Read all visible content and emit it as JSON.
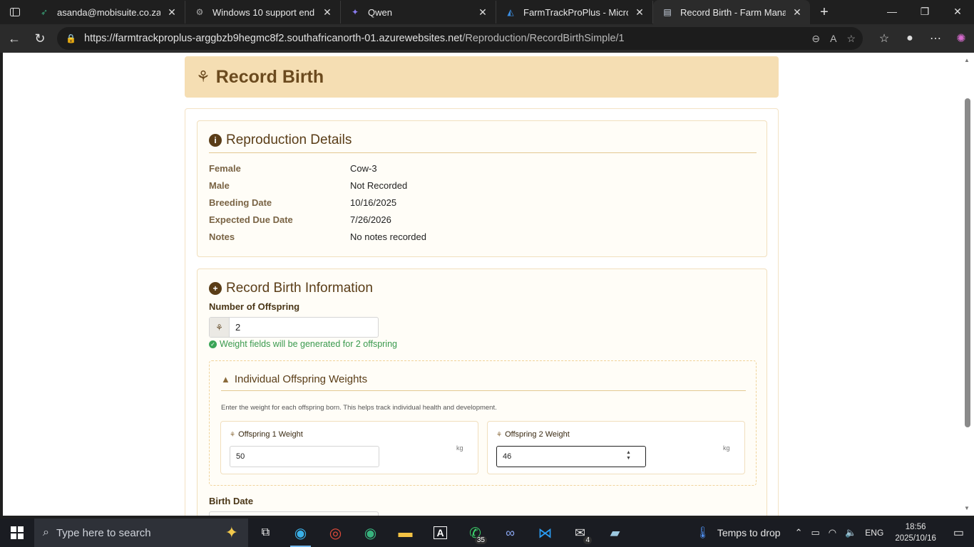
{
  "browser": {
    "tabs": [
      {
        "title": "asanda@mobisuite.co.za | Mo",
        "icon": "leaf-icon",
        "color": "#3aa57a"
      },
      {
        "title": "Windows 10 support end",
        "icon": "gear-icon",
        "color": "#9a9a9a"
      },
      {
        "title": "Qwen",
        "icon": "qwen-icon",
        "color": "#8a7cf0"
      },
      {
        "title": "FarmTrackProPlus - Microsoft",
        "icon": "azure-icon",
        "color": "#3b8de0"
      },
      {
        "title": "Record Birth - Farm Managem",
        "icon": "page-icon",
        "color": "#cfd8e6",
        "active": true
      }
    ],
    "url_host": "https://farmtrackproplus-arggbzb9hegmc8f2.southafricanorth-01.azurewebsites.net",
    "url_path": "/Reproduction/RecordBirthSimple/1"
  },
  "page": {
    "title": "Record Birth",
    "details": {
      "title": "Reproduction Details",
      "rows": [
        {
          "label": "Female",
          "value": "Cow-3"
        },
        {
          "label": "Male",
          "value": "Not Recorded"
        },
        {
          "label": "Breeding Date",
          "value": "10/16/2025"
        },
        {
          "label": "Expected Due Date",
          "value": "7/26/2026"
        },
        {
          "label": "Notes",
          "value": "No notes recorded"
        }
      ]
    },
    "birth": {
      "title": "Record Birth Information",
      "offspring_label": "Number of Offspring",
      "offspring_value": "2",
      "hint": "Weight fields will be generated for 2 offspring",
      "weights_title": "Individual Offspring Weights",
      "weights_desc": "Enter the weight for each offspring born. This helps track individual health and development.",
      "weights": [
        {
          "label": "Offspring 1 Weight",
          "value": "50",
          "unit": "kg"
        },
        {
          "label": "Offspring 2 Weight",
          "value": "46",
          "unit": "kg"
        }
      ],
      "birth_date_label": "Birth Date"
    }
  },
  "taskbar": {
    "search_placeholder": "Type here to search",
    "whatsapp_badge": "35",
    "outlook_badge": "4",
    "weather": "Temps to drop",
    "lang": "ENG",
    "time": "18:56",
    "date": "2025/10/16"
  }
}
